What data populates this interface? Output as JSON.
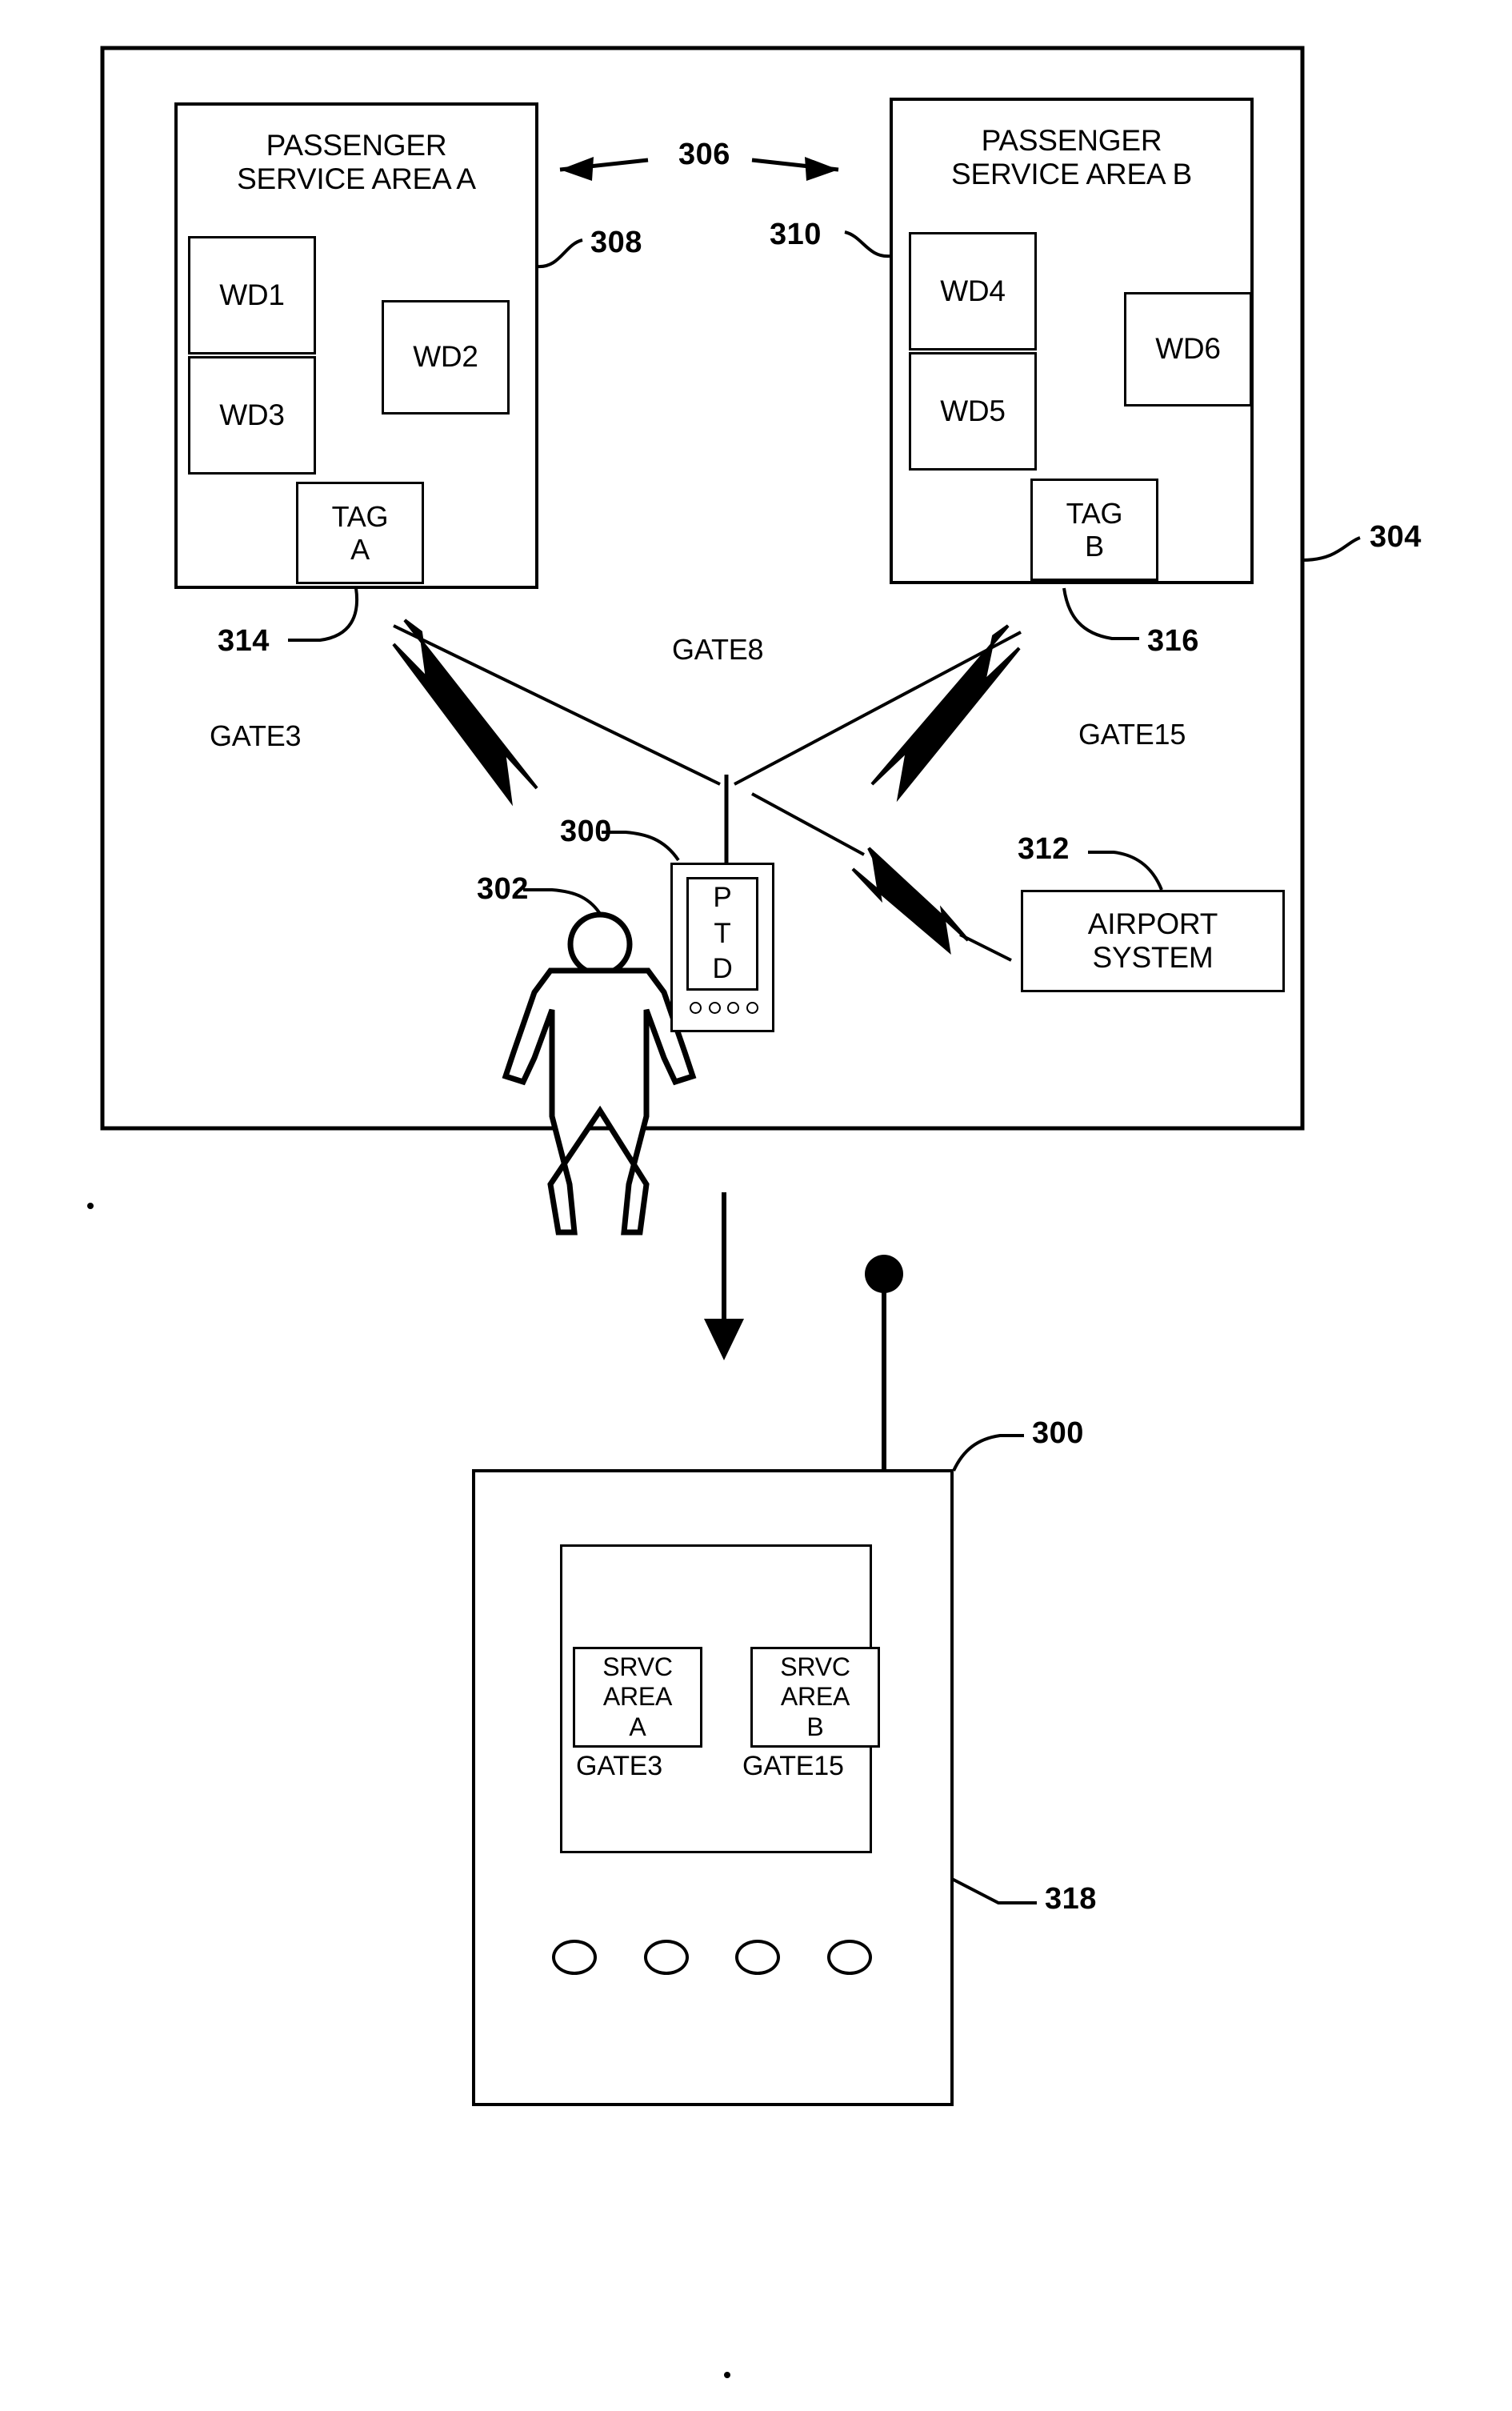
{
  "figure": {
    "outer_enclosure_ref": "304",
    "interconnect_ref": "306",
    "areas": [
      {
        "ref": "308",
        "title": "PASSENGER\nSERVICE AREA A",
        "devices": [
          "WD1",
          "WD2",
          "WD3"
        ],
        "tag": {
          "label": "TAG\nA",
          "ref": "314"
        },
        "gate": "GATE3"
      },
      {
        "ref": "310",
        "title": "PASSENGER\nSERVICE AREA B",
        "devices": [
          "WD4",
          "WD5",
          "WD6"
        ],
        "tag": {
          "label": "TAG\nB",
          "ref": "316"
        },
        "gate": "GATE15"
      }
    ],
    "center_gate": "GATE8",
    "airport_system": {
      "label": "AIRPORT\nSYSTEM",
      "ref": "312"
    },
    "person": {
      "ref": "302"
    },
    "ptd_top": {
      "ref": "300",
      "screen_text": "P\nT\nD",
      "button_count": 4
    },
    "ptd_bottom": {
      "ref": "300",
      "display_ref": "318",
      "button_count": 4,
      "entries": [
        {
          "box_text": "SRVC\nAREA\nA",
          "gate": "GATE3"
        },
        {
          "box_text": "SRVC\nAREA\nB",
          "gate": "GATE15"
        }
      ]
    }
  },
  "colors": {
    "ink": "#000000",
    "paper": "#ffffff"
  }
}
